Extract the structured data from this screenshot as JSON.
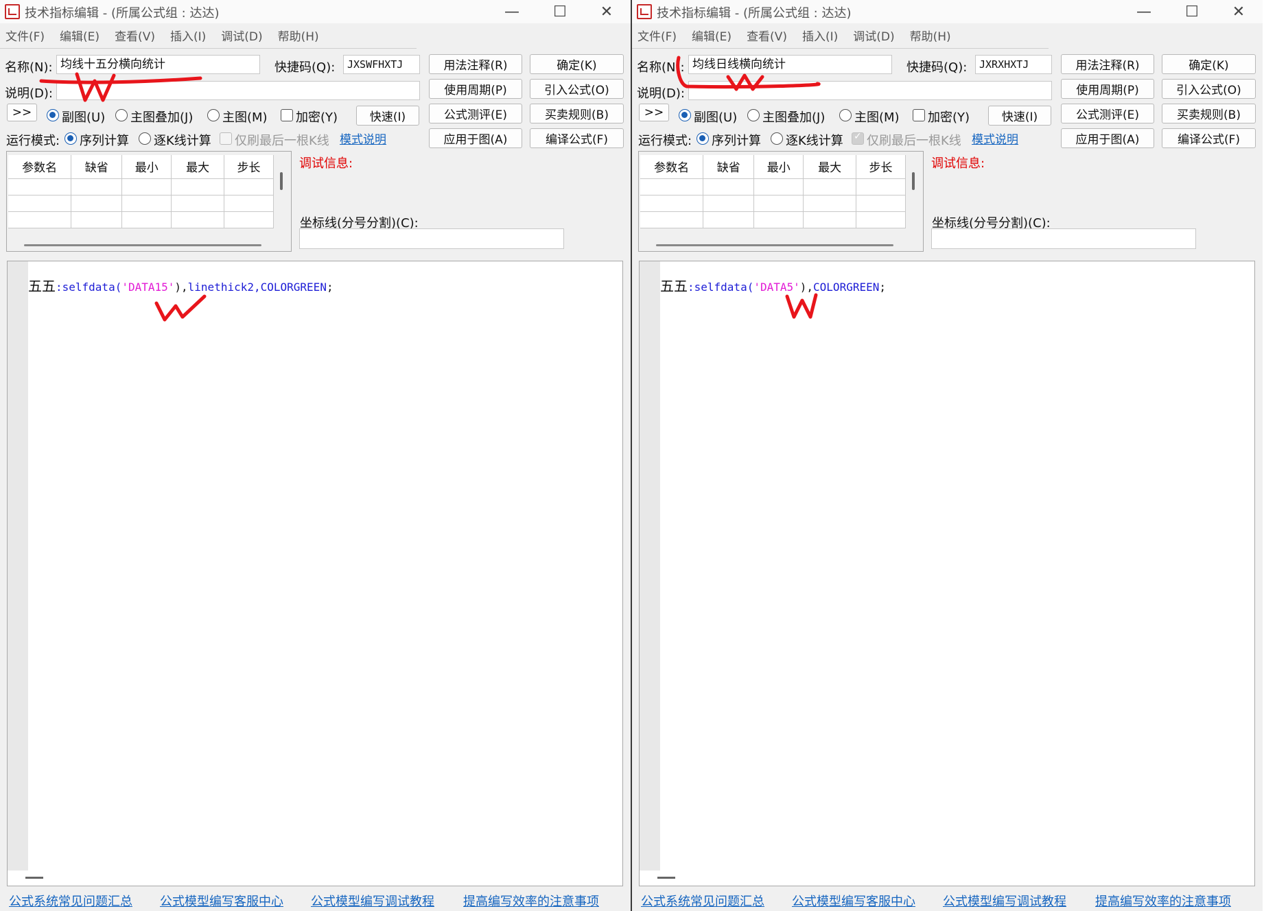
{
  "windows": [
    {
      "title": "技术指标编辑 - (所属公式组 : 达达)",
      "menus": [
        "文件(F)",
        "编辑(E)",
        "查看(V)",
        "插入(I)",
        "调试(D)",
        "帮助(H)"
      ],
      "name_label": "名称(N):",
      "name_value": "均线十五分横向统计",
      "shortcut_label": "快捷码(Q):",
      "shortcut_value": "JXSWFHXTJ",
      "desc_label": "说明(D):",
      "desc_value": "",
      "expand_label": ">>",
      "radios": [
        "副图(U)",
        "主图叠加(J)",
        "主图(M)"
      ],
      "encrypt_label": "加密(Y)",
      "fast_button": "快速(I)",
      "run_mode_label": "运行模式:",
      "run_modes": [
        "序列计算",
        "逐K线计算"
      ],
      "last_bar_label": "仅刷最后一根K线",
      "mode_help_link": "模式说明",
      "buttons": {
        "usage_notes": "用法注释(R)",
        "confirm": "确定(K)",
        "period": "使用周期(P)",
        "import": "引入公式(O)",
        "evaluate": "公式测评(E)",
        "trade_rules": "买卖规则(B)",
        "apply_chart": "应用于图(A)",
        "compile": "编译公式(F)"
      },
      "param_headers": [
        "参数名",
        "缺省",
        "最小",
        "最大",
        "步长"
      ],
      "debug_label": "调试信息:",
      "axis_label": "坐标线(分号分割)(C):",
      "axis_value": "",
      "code": {
        "name": "五五",
        "fn": ":selfdata(",
        "str": "'DATA15'",
        "close": "),",
        "extra": "linethick2,COLORGREEN",
        "end": ";"
      },
      "footer_links": [
        "公式系统常见问题汇总",
        "公式模型编写客服中心",
        "公式模型编写调试教程",
        "提高编写效率的注意事项"
      ],
      "last_bar_checked": false
    },
    {
      "title": "技术指标编辑 - (所属公式组 : 达达)",
      "menus": [
        "文件(F)",
        "编辑(E)",
        "查看(V)",
        "插入(I)",
        "调试(D)",
        "帮助(H)"
      ],
      "name_label": "名称(N):",
      "name_value": "均线日线横向统计",
      "shortcut_label": "快捷码(Q):",
      "shortcut_value": "JXRXHXTJ",
      "desc_label": "说明(D):",
      "desc_value": "",
      "expand_label": ">>",
      "radios": [
        "副图(U)",
        "主图叠加(J)",
        "主图(M)"
      ],
      "encrypt_label": "加密(Y)",
      "fast_button": "快速(I)",
      "run_mode_label": "运行模式:",
      "run_modes": [
        "序列计算",
        "逐K线计算"
      ],
      "last_bar_label": "仅刷最后一根K线",
      "mode_help_link": "模式说明",
      "buttons": {
        "usage_notes": "用法注释(R)",
        "confirm": "确定(K)",
        "period": "使用周期(P)",
        "import": "引入公式(O)",
        "evaluate": "公式测评(E)",
        "trade_rules": "买卖规则(B)",
        "apply_chart": "应用于图(A)",
        "compile": "编译公式(F)"
      },
      "param_headers": [
        "参数名",
        "缺省",
        "最小",
        "最大",
        "步长"
      ],
      "debug_label": "调试信息:",
      "axis_label": "坐标线(分号分割)(C):",
      "axis_value": "",
      "code": {
        "name": "五五",
        "fn": ":selfdata(",
        "str": "'DATA5'",
        "close": "),",
        "extra": "COLORGREEN",
        "end": ";"
      },
      "footer_links": [
        "公式系统常见问题汇总",
        "公式模型编写客服中心",
        "公式模型编写调试教程",
        "提高编写效率的注意事项"
      ],
      "last_bar_checked": true
    }
  ],
  "colors": {
    "window_bg": "#f0f0f0",
    "debug_text": "#e00000",
    "link": "#1565c0",
    "code_function": "#1d1dd6",
    "code_string": "#e21ad5",
    "annotation": "#e8151b"
  },
  "icons": [
    "app-icon",
    "minimize-icon",
    "maximize-icon",
    "close-icon"
  ]
}
